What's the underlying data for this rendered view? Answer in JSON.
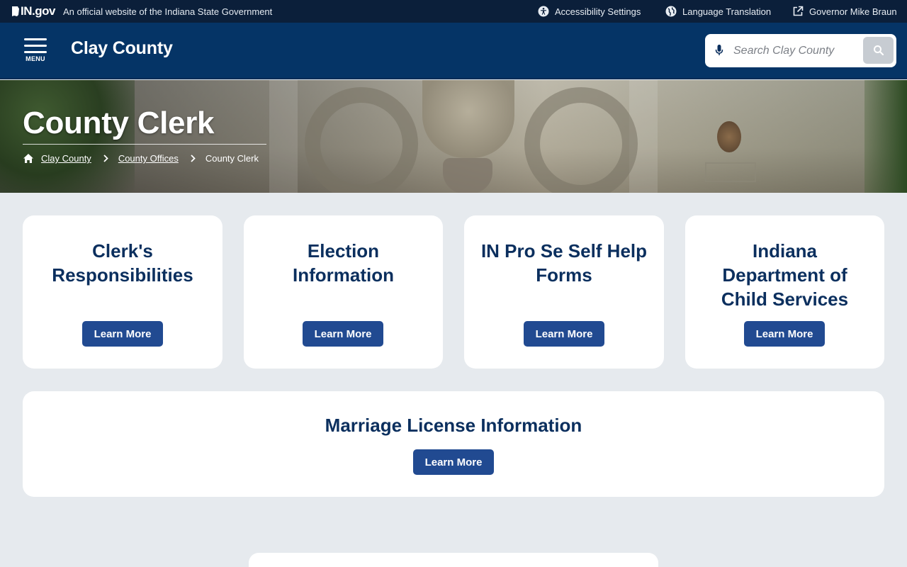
{
  "topbar": {
    "logo_text": "IN.gov",
    "official_text": "An official website of the Indiana State Government",
    "accessibility_label": "Accessibility Settings",
    "language_label": "Language Translation",
    "governor_label": "Governor Mike Braun"
  },
  "header": {
    "menu_label": "MENU",
    "site_title": "Clay County",
    "search_placeholder": "Search Clay County"
  },
  "hero": {
    "title": "County Clerk",
    "breadcrumb": [
      {
        "label": "Clay County"
      },
      {
        "label": "County Offices"
      },
      {
        "label": "County Clerk"
      }
    ]
  },
  "cards": [
    {
      "title": "Clerk's Responsibilities",
      "button": "Learn More"
    },
    {
      "title": "Election Information",
      "button": "Learn More"
    },
    {
      "title": "IN Pro Se Self Help Forms",
      "button": "Learn More"
    },
    {
      "title": "Indiana Department of Child Services",
      "button": "Learn More"
    }
  ],
  "wide_card": {
    "title": "Marriage License Information",
    "button": "Learn More"
  },
  "colors": {
    "topbar_bg": "#0b1f3a",
    "header_bg": "#053466",
    "page_bg": "#e6eaee",
    "card_title": "#0b2f5e",
    "button_bg": "#214a91"
  },
  "icons": {
    "accessibility": "accessibility-icon",
    "language": "globe-icon",
    "governor": "external-link-icon",
    "mic": "microphone-icon",
    "search": "search-icon",
    "home": "home-icon",
    "breadcrumb_sep": "chevron-right-icon"
  }
}
